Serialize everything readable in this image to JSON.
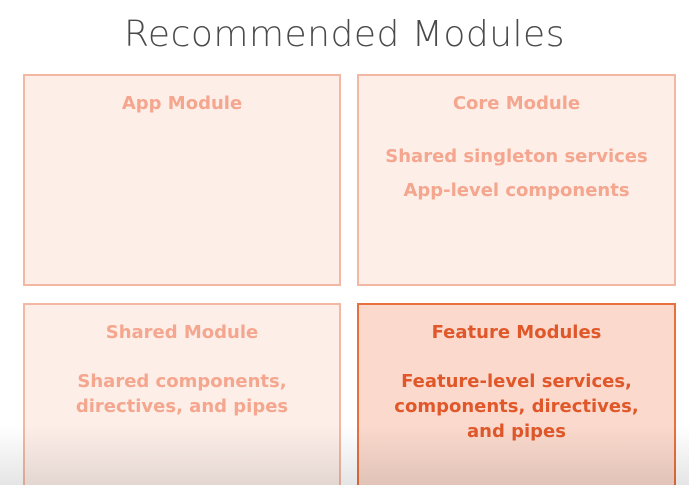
{
  "title": "Recommended Modules",
  "cards": [
    {
      "heading": "App Module",
      "lines": []
    },
    {
      "heading": "Core Module",
      "lines": [
        "Shared singleton services",
        "App-level components"
      ]
    },
    {
      "heading": "Shared Module",
      "lines": [
        "Shared components,",
        "directives, and pipes"
      ]
    },
    {
      "heading": "Feature Modules",
      "lines": [
        "Feature-level services,",
        "components, directives,",
        "and pipes"
      ]
    }
  ],
  "active_card": "Feature Modules",
  "colors": {
    "title_text": "#4a4a4a",
    "card_border": "#f4b7a4",
    "card_fill": "#fdeee8",
    "card_text": "#f4a68e",
    "active_border": "#e8703f",
    "active_fill": "#fbd9cd",
    "active_text": "#e0582a"
  }
}
